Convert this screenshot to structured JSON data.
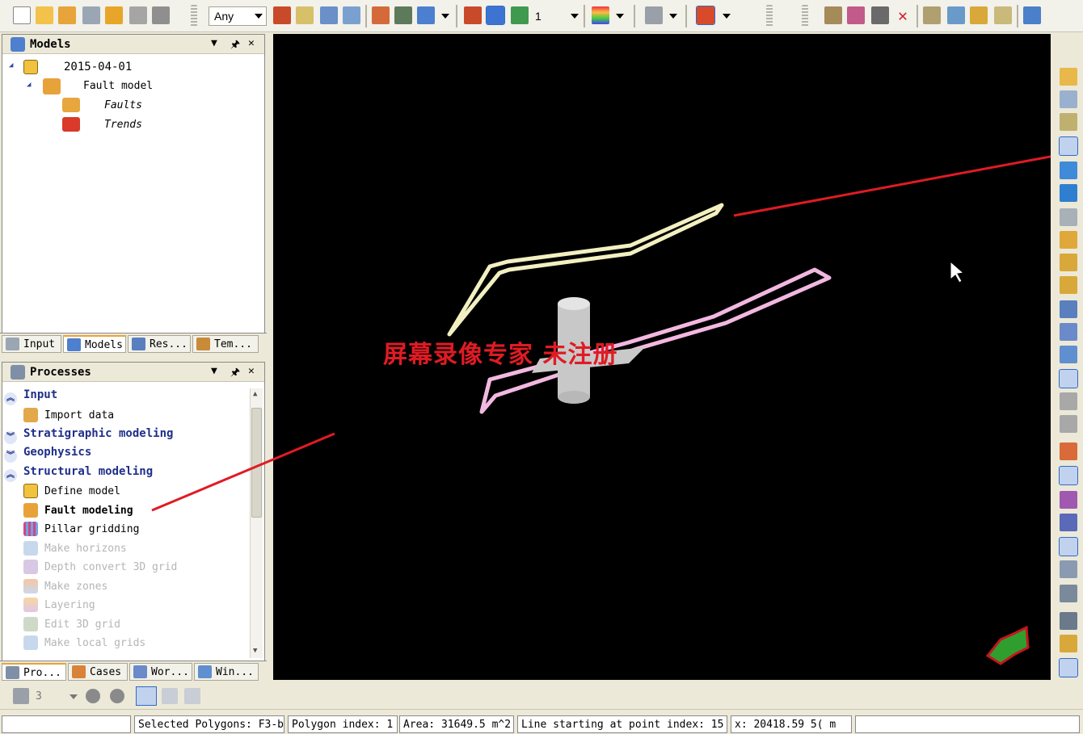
{
  "toolbar": {
    "filter_combo": "Any",
    "counter_value": "1"
  },
  "models_panel": {
    "title": "Models",
    "tree": [
      {
        "label": "2015-04-01",
        "level": 0
      },
      {
        "label": "Fault model",
        "level": 1
      },
      {
        "label": "Faults",
        "level": 2
      },
      {
        "label": "Trends",
        "level": 2
      }
    ],
    "tabs": [
      "Input",
      "Models",
      "Res...",
      "Tem..."
    ]
  },
  "processes_panel": {
    "title": "Processes",
    "groups": [
      {
        "label": "Input",
        "expanded": true
      },
      {
        "label": "Import data",
        "type": "item"
      },
      {
        "label": "Stratigraphic modeling",
        "expanded": false
      },
      {
        "label": "Geophysics",
        "expanded": false
      },
      {
        "label": "Structural modeling",
        "expanded": true
      },
      {
        "label": "Define model",
        "type": "item"
      },
      {
        "label": "Fault modeling",
        "type": "item",
        "bold": true
      },
      {
        "label": "Pillar gridding",
        "type": "item"
      },
      {
        "label": "Make horizons",
        "type": "item",
        "disabled": true
      },
      {
        "label": "Depth convert 3D grid",
        "type": "item",
        "disabled": true
      },
      {
        "label": "Make zones",
        "type": "item",
        "disabled": true
      },
      {
        "label": "Layering",
        "type": "item",
        "disabled": true
      },
      {
        "label": "Edit 3D grid",
        "type": "item",
        "disabled": true
      },
      {
        "label": "Make local grids",
        "type": "item",
        "disabled": true
      }
    ],
    "tabs": [
      "Pro...",
      "Cases",
      "Wor...",
      "Win..."
    ]
  },
  "viewport": {
    "watermark": "屏幕录像专家 未注册",
    "background": "#000000"
  },
  "bottom_bar": {
    "value": "3"
  },
  "status": {
    "selected": "Selected Polygons: F3-b",
    "polygon_index": "Polygon index: 1",
    "area": "Area: 31649.5 m^2",
    "line_start": "Line starting at point index: 15",
    "coords": "x: 20418.59 5( m"
  },
  "colors": {
    "fault_a": "#f2f0c0",
    "fault_b": "#f2b8e0",
    "pillar": "#c8c8c8",
    "annotation": "#e01b24",
    "watermark": "#e01b24"
  }
}
